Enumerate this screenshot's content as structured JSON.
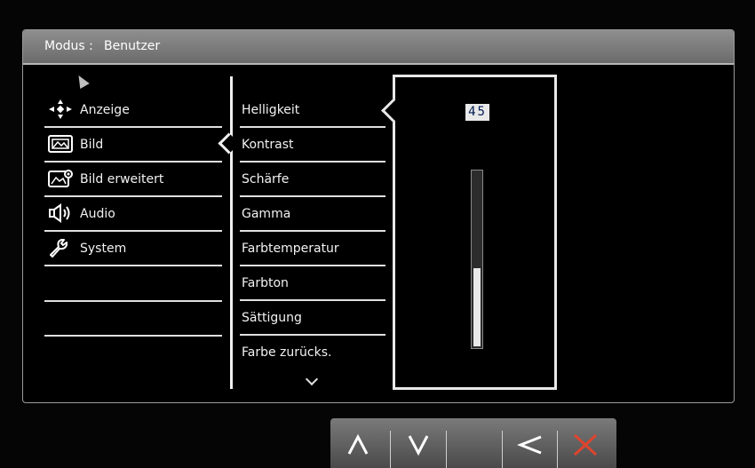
{
  "header": {
    "mode_label": "Modus :",
    "mode_value": "Benutzer"
  },
  "main_menu": [
    {
      "label": "Anzeige",
      "icon": "display-adjust-icon",
      "selected": false
    },
    {
      "label": "Bild",
      "icon": "picture-icon",
      "selected": true
    },
    {
      "label": "Bild erweitert",
      "icon": "picture-advanced-icon",
      "selected": false
    },
    {
      "label": "Audio",
      "icon": "speaker-icon",
      "selected": false
    },
    {
      "label": "System",
      "icon": "wrench-icon",
      "selected": false
    }
  ],
  "sub_menu": [
    {
      "label": "Helligkeit",
      "selected": true
    },
    {
      "label": "Kontrast"
    },
    {
      "label": "Schärfe"
    },
    {
      "label": "Gamma"
    },
    {
      "label": "Farbtemperatur"
    },
    {
      "label": "Farbton"
    },
    {
      "label": "Sättigung"
    },
    {
      "label": "Farbe zurücks."
    }
  ],
  "value_panel": {
    "value": "45",
    "slider_fraction": 0.45
  },
  "toolbar": [
    {
      "name": "up-button",
      "icon": "chevron-up-icon"
    },
    {
      "name": "down-button",
      "icon": "chevron-down-icon"
    },
    {
      "name": "blank-button",
      "icon": ""
    },
    {
      "name": "back-button",
      "icon": "chevron-left-icon"
    },
    {
      "name": "exit-button",
      "icon": "close-icon"
    }
  ],
  "colors": {
    "exit": "#e0442e",
    "value_text": "#001c52"
  }
}
